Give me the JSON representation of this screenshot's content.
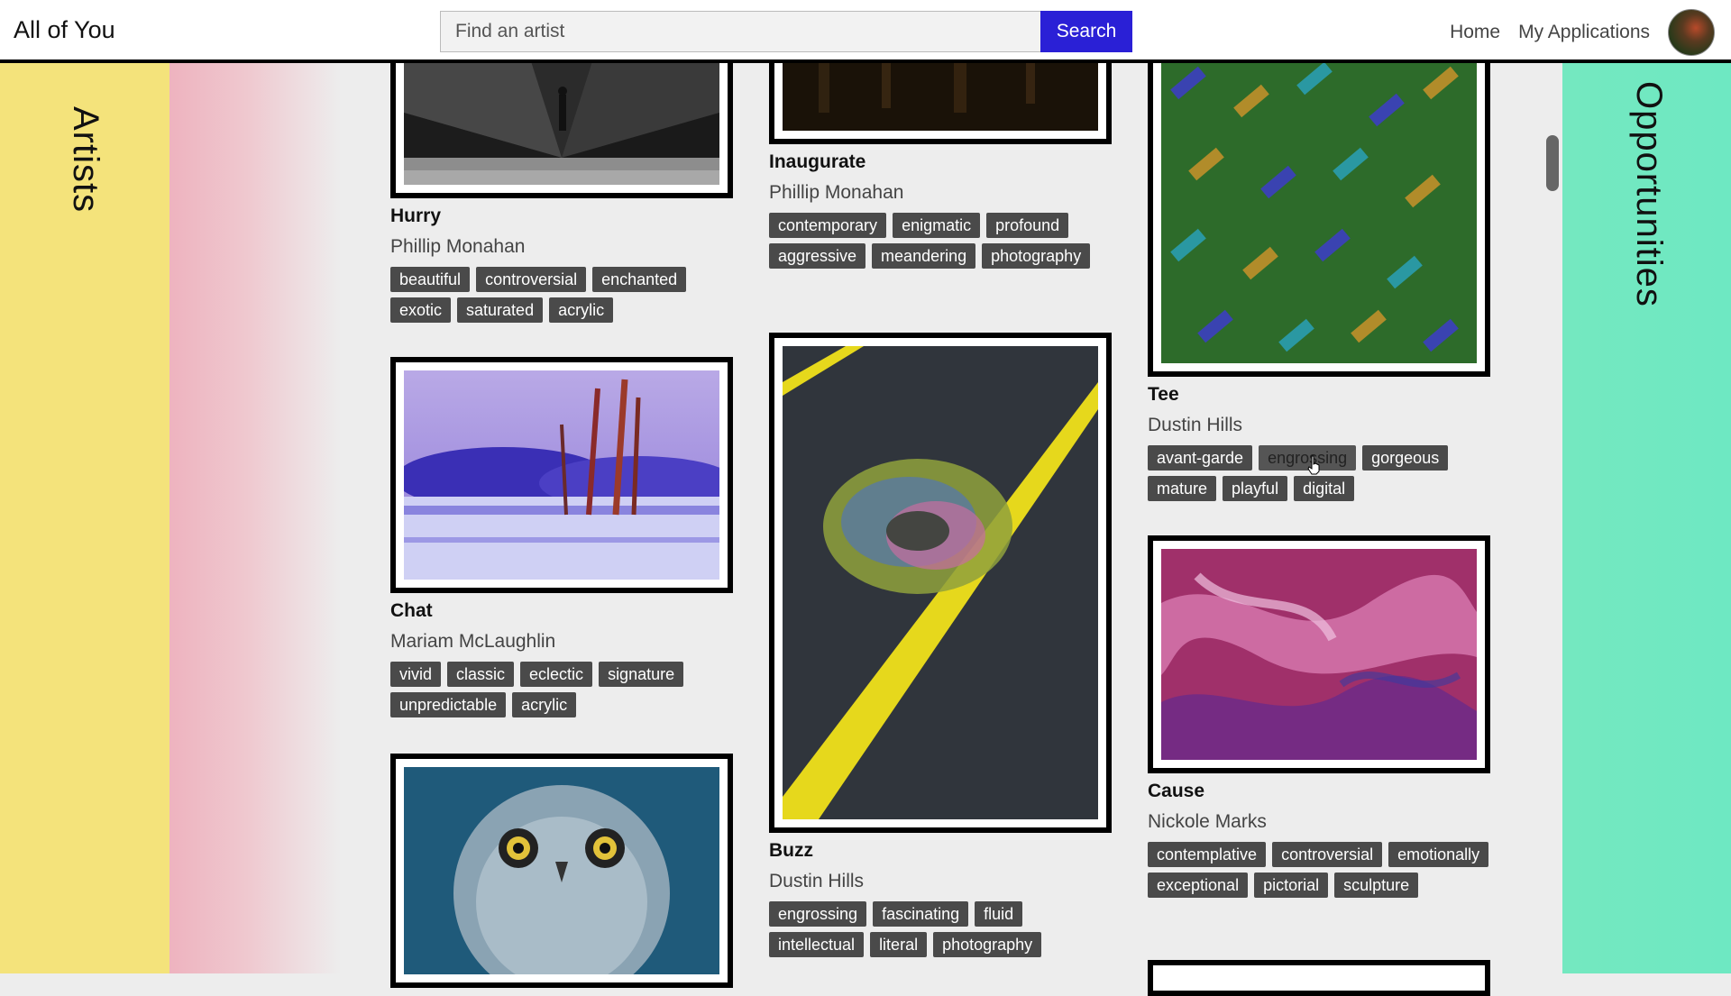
{
  "header": {
    "brand": "All of You",
    "search_placeholder": "Find an artist",
    "search_button": "Search",
    "nav_home": "Home",
    "nav_applications": "My Applications"
  },
  "side": {
    "left_label": "Artists",
    "right_label": "Opportunities"
  },
  "colors": {
    "accent": "#2a20d6",
    "left_panel": "#f4e37b",
    "right_panel": "#74e8c0",
    "tag_bg": "#4a4a4a"
  },
  "cards": {
    "hurry": {
      "title": "Hurry",
      "artist": "Phillip Monahan",
      "tags": [
        "beautiful",
        "controversial",
        "enchanted",
        "exotic",
        "saturated",
        "acrylic"
      ]
    },
    "chat": {
      "title": "Chat",
      "artist": "Mariam McLaughlin",
      "tags": [
        "vivid",
        "classic",
        "eclectic",
        "signature",
        "unpredictable",
        "acrylic"
      ]
    },
    "inaugurate": {
      "title": "Inaugurate",
      "artist": "Phillip Monahan",
      "tags": [
        "contemporary",
        "enigmatic",
        "profound",
        "aggressive",
        "meandering",
        "photography"
      ]
    },
    "buzz": {
      "title": "Buzz",
      "artist": "Dustin Hills",
      "tags": [
        "engrossing",
        "fascinating",
        "fluid",
        "intellectual",
        "literal",
        "photography"
      ]
    },
    "tee": {
      "title": "Tee",
      "artist": "Dustin Hills",
      "tags": [
        "avant-garde",
        "engrossing",
        "gorgeous",
        "mature",
        "playful",
        "digital"
      ]
    },
    "cause": {
      "title": "Cause",
      "artist": "Nickole Marks",
      "tags": [
        "contemplative",
        "controversial",
        "emotionally",
        "exceptional",
        "pictorial",
        "sculpture"
      ]
    }
  }
}
